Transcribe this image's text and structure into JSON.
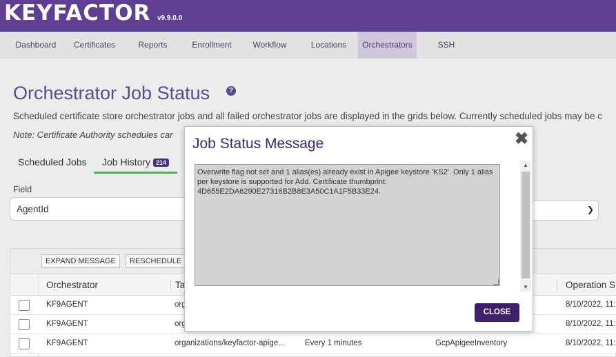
{
  "header": {
    "logo": "KEYFACTOR",
    "version": "v9.9.0.0"
  },
  "nav": {
    "items": [
      "Dashboard",
      "Certificates",
      "Reports",
      "Enrollment",
      "Workflow",
      "Locations",
      "Orchestrators",
      "SSH"
    ],
    "active": "Orchestrators"
  },
  "page": {
    "title": "Orchestrator Job Status",
    "description": "Scheduled certificate store orchestrator jobs and all failed orchestrator jobs are displayed in the grids below. Currently scheduled jobs may be c",
    "note": "Note: Certificate Authority schedules car"
  },
  "tabs": [
    {
      "label": "Scheduled Jobs"
    },
    {
      "label": "Job History",
      "badge": "214"
    }
  ],
  "filter": {
    "field_label": "Field",
    "field_value": "AgentId"
  },
  "grid": {
    "toolbar": {
      "expand_label": "EXPAND MESSAGE",
      "reschedule_label": "RESCHEDULE"
    },
    "columns": [
      "Orchestrator",
      "Ta",
      "Operation S"
    ],
    "rows": [
      {
        "orchestrator": "KF9AGENT",
        "target": "org",
        "schedule": "",
        "type": "",
        "operation": "8/10/2022, 11:"
      },
      {
        "orchestrator": "KF9AGENT",
        "target": "org",
        "schedule": "",
        "type": "",
        "operation": "8/10/2022, 11:"
      },
      {
        "orchestrator": "KF9AGENT",
        "target": "organizations/keyfactor-apige...",
        "schedule": "Every 1 minutes",
        "type": "GcpApigeeInventory",
        "operation": "8/10/2022, 11:"
      }
    ]
  },
  "modal": {
    "title": "Job Status Message",
    "message": "Overwrite flag not set and 1 alias(es) already exist in Apigee keystore 'KS2'. Only 1 alias per keystore is supported for Add. Certificate thumbprint: 4D655E2DA6290E27316B2B8E3A50C1A1F5B33E24.",
    "close_label": "CLOSE"
  },
  "colors": {
    "brand": "#5f3f91",
    "nav_active": "#cfc8dc",
    "tab_underline": "#4caf50",
    "close_button": "#3d1f6b"
  }
}
